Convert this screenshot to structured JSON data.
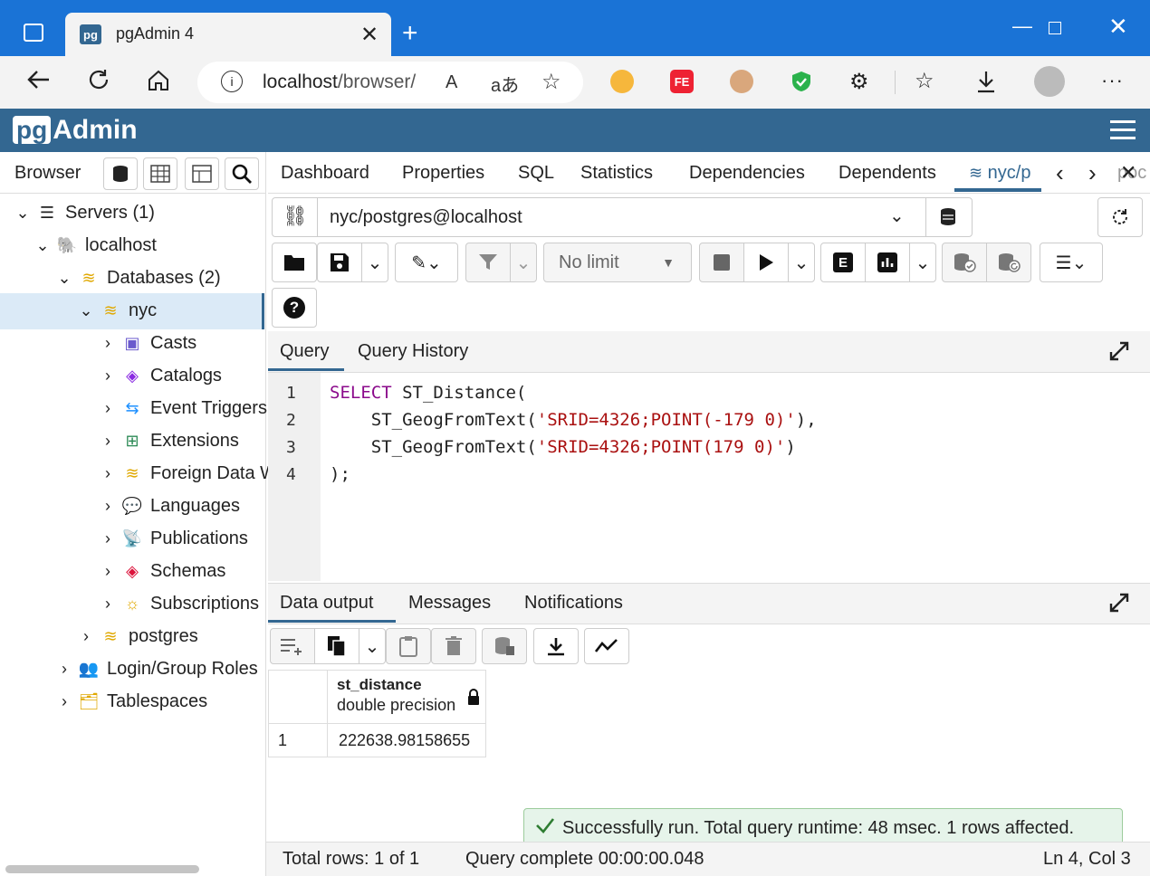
{
  "window": {
    "tab_title": "pgAdmin 4",
    "tab_favicon": "pg",
    "new_tab": "+",
    "minimize": "—",
    "close": "✕"
  },
  "addressbar": {
    "host": "localhost",
    "path": "/browser/"
  },
  "app": {
    "logo_pg": "pg",
    "logo_text": "Admin"
  },
  "browser": {
    "label": "Browser",
    "tree": [
      {
        "label": "Servers (1)",
        "icon": "servers-icon"
      },
      {
        "label": "localhost",
        "icon": "postgres-elephant-icon"
      },
      {
        "label": "Databases (2)",
        "icon": "databases-icon"
      },
      {
        "label": "nyc",
        "icon": "database-icon"
      },
      {
        "label": "Casts",
        "icon": "casts-icon"
      },
      {
        "label": "Catalogs",
        "icon": "catalogs-icon"
      },
      {
        "label": "Event Triggers",
        "icon": "event-triggers-icon"
      },
      {
        "label": "Extensions",
        "icon": "extensions-icon"
      },
      {
        "label": "Foreign Data W",
        "icon": "foreign-data-icon"
      },
      {
        "label": "Languages",
        "icon": "languages-icon"
      },
      {
        "label": "Publications",
        "icon": "publications-icon"
      },
      {
        "label": "Schemas",
        "icon": "schemas-icon"
      },
      {
        "label": "Subscriptions",
        "icon": "subscriptions-icon"
      },
      {
        "label": "postgres",
        "icon": "database-icon"
      },
      {
        "label": "Login/Group Roles",
        "icon": "roles-icon"
      },
      {
        "label": "Tablespaces",
        "icon": "tablespaces-icon"
      }
    ]
  },
  "main_tabs": [
    "Dashboard",
    "Properties",
    "SQL",
    "Statistics",
    "Dependencies",
    "Dependents",
    "nyc/p",
    "poc"
  ],
  "query_tool": {
    "connection": "nyc/postgres@localhost",
    "limit": "No limit",
    "tabs": [
      "Query",
      "Query History"
    ],
    "lines": [
      "1",
      "2",
      "3",
      "4"
    ],
    "code": {
      "l1_kw": "SELECT",
      "l1_rest": " ST_Distance(",
      "l2_fn": "    ST_GeogFromText(",
      "l2_str": "'SRID=4326;POINT(-179 0)'",
      "l2_end": "),",
      "l3_fn": "    ST_GeogFromText(",
      "l3_str": "'SRID=4326;POINT(179 0)'",
      "l3_end": ")",
      "l4": ");"
    }
  },
  "output": {
    "tabs": [
      "Data output",
      "Messages",
      "Notifications"
    ],
    "column_name": "st_distance",
    "column_type": "double precision",
    "rows": [
      {
        "num": "1",
        "value": "222638.98158655"
      }
    ]
  },
  "toast": "Successfully run. Total query runtime: 48 msec. 1 rows affected.",
  "status": {
    "total_rows": "Total rows: 1 of 1",
    "query_complete": "Query complete 00:00:00.048",
    "cursor": "Ln 4, Col 3"
  }
}
